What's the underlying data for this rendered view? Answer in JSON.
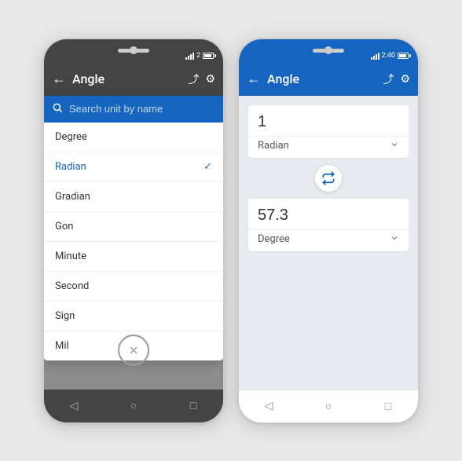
{
  "phone1": {
    "status_bar": {
      "signal": "full",
      "time": "2",
      "battery": "full"
    },
    "header": {
      "back_label": "←",
      "title": "Angle",
      "share_label": "⤴",
      "settings_label": "⚙"
    },
    "search": {
      "placeholder": "Search unit by name",
      "icon": "search"
    },
    "units": [
      {
        "name": "Degree",
        "selected": false
      },
      {
        "name": "Radian",
        "selected": true
      },
      {
        "name": "Gradian",
        "selected": false
      },
      {
        "name": "Gon",
        "selected": false
      },
      {
        "name": "Minute",
        "selected": false
      },
      {
        "name": "Second",
        "selected": false
      },
      {
        "name": "Sign",
        "selected": false
      },
      {
        "name": "Mil",
        "selected": false
      }
    ],
    "close_btn": "✕",
    "nav": {
      "back": "◁",
      "home": "○",
      "recent": "□"
    }
  },
  "phone2": {
    "status_bar": {
      "signal": "full",
      "time": "2:40",
      "battery": "full"
    },
    "header": {
      "back_label": "←",
      "title": "Angle",
      "share_label": "⤴",
      "settings_label": "⚙"
    },
    "from_value": "1",
    "from_unit": "Radian",
    "to_value": "57.3",
    "to_unit": "Degree",
    "swap_icon": "⇅",
    "nav": {
      "back": "◁",
      "home": "○",
      "recent": "□"
    }
  },
  "icons": {
    "search": "🔍",
    "back": "←",
    "share": "⤴",
    "settings": "⚙",
    "check": "✓",
    "close": "✕",
    "swap": "⇅",
    "back_nav": "◁",
    "home_nav": "○",
    "recent_nav": "□"
  }
}
